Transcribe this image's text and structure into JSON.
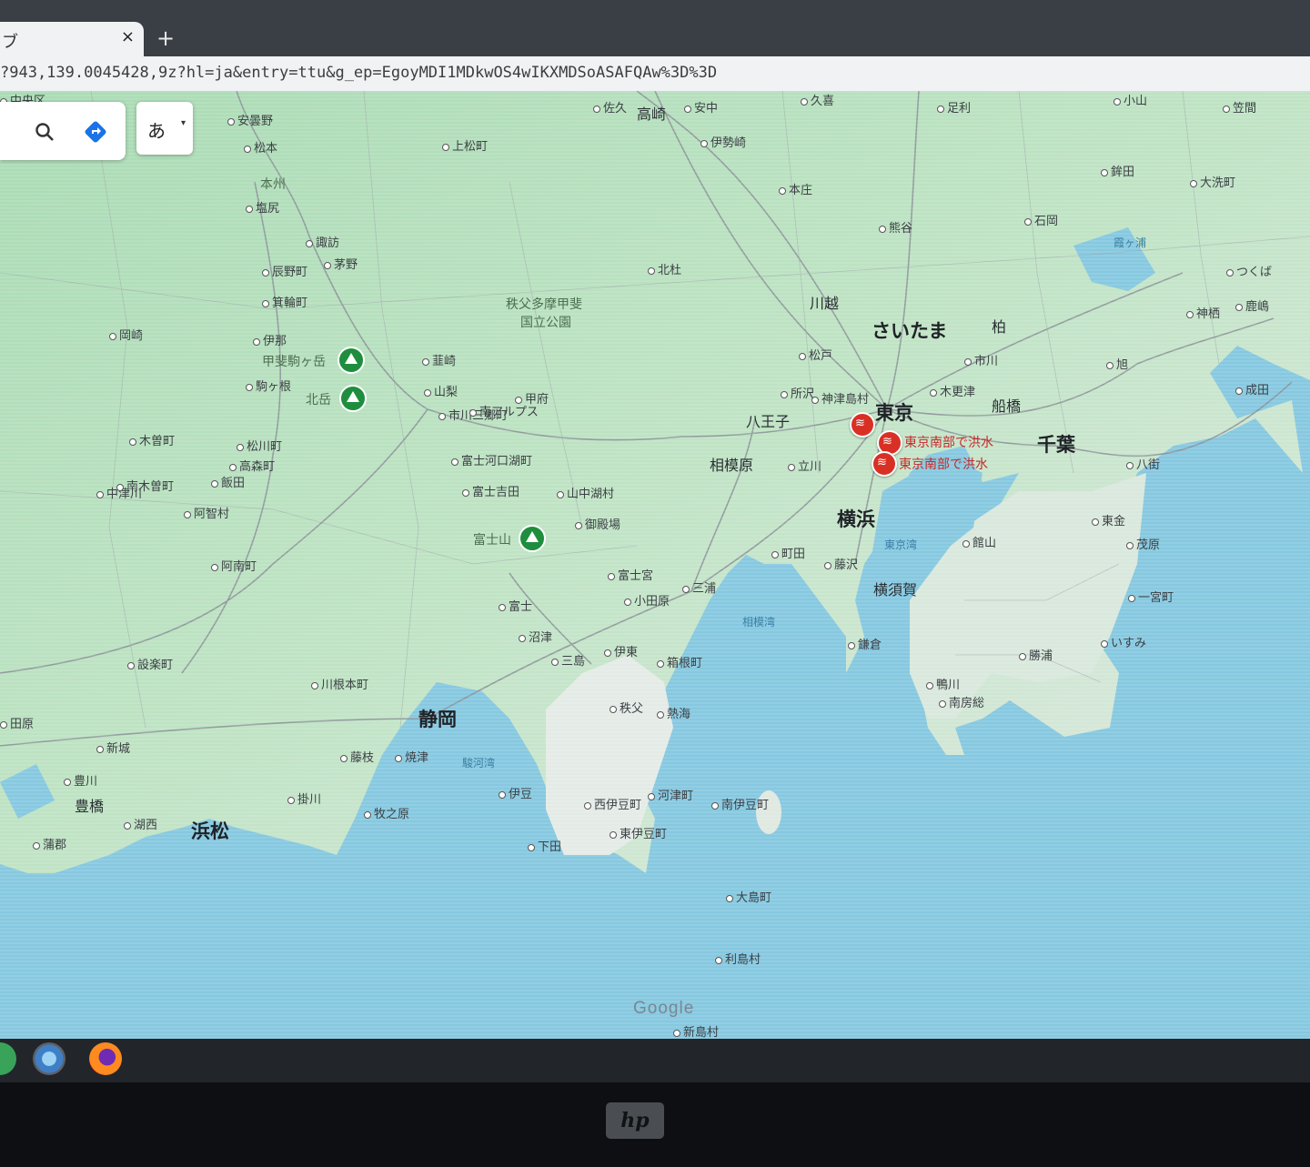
{
  "browser": {
    "tab_title": "ブ",
    "tab_close": "×",
    "new_tab": "+",
    "url": "?943,139.0045428,9z?hl=ja&entry=ttu&g_ep=EgoyMDI1MDkwOS4wIKXMDSoASAFQAw%3D%3D"
  },
  "map_controls": {
    "search_icon": "search-icon",
    "directions_icon": "directions-icon",
    "ime_label": "あ",
    "ime_caret": "▾"
  },
  "colors": {
    "land_low": "#e9ecea",
    "land_high": "#a7d9b2",
    "sea": "#86c8e0",
    "road": "#8a9097",
    "alert": "#d93025",
    "park": "#1e8e3e"
  },
  "labels": {
    "cities": [
      "東京",
      "さいたま",
      "横浜",
      "千葉",
      "静岡",
      "浜松"
    ],
    "mid": [
      "高崎",
      "川越",
      "八王子",
      "相模原",
      "横須賀",
      "船橋",
      "豊橋",
      "柏"
    ],
    "towns": [
      "安曇野",
      "松本",
      "塩尻",
      "諏訪",
      "茅野",
      "辰野町",
      "箕輪町",
      "伊那",
      "駒ヶ根",
      "松川町",
      "高森町",
      "飯田",
      "中津川",
      "阿智村",
      "阿南町",
      "設楽町",
      "川根本町",
      "藤枝",
      "焼津",
      "掛川",
      "牧之原",
      "湖西",
      "新城",
      "豊川",
      "蒲郡",
      "田原",
      "岡崎",
      "木曽町",
      "南木曽町",
      "上松町",
      "佐久",
      "安中",
      "伊勢崎",
      "本庄",
      "熊谷",
      "久喜",
      "足利",
      "小山",
      "笠間",
      "大洗町",
      "鉾田",
      "石岡",
      "つくば",
      "鹿嶋",
      "神栖",
      "成田",
      "旭",
      "八街",
      "東金",
      "茂原",
      "一宮町",
      "いすみ",
      "勝浦",
      "鴨川",
      "南房総",
      "館山",
      "木更津",
      "市川",
      "松戸",
      "所沢",
      "立川",
      "町田",
      "藤沢",
      "鎌倉",
      "三浦",
      "小田原",
      "箱根町",
      "熱海",
      "伊東",
      "三島",
      "沼津",
      "富士",
      "富士宮",
      "御殿場",
      "山中湖村",
      "富士吉田",
      "富士河口湖町",
      "市川三郷町",
      "南アルプス",
      "甲府",
      "山梨",
      "韮崎",
      "北杜",
      "秩父",
      "伊豆",
      "西伊豆町",
      "河津町",
      "東伊豆町",
      "下田",
      "南伊豆町",
      "大島町",
      "利島村",
      "新島村",
      "神津島村",
      "中央区"
    ],
    "parks": [
      "秩父多摩甲斐",
      "国立公園",
      "甲斐駒ヶ岳",
      "北岳",
      "富士山",
      "本州"
    ],
    "sea": [
      "相模湾",
      "駿河湾",
      "東京湾",
      "霞ヶ浦"
    ],
    "alerts": [
      "東京南部で洪水",
      "東京南部で洪水"
    ]
  },
  "google_logo": "Google",
  "taskbar": {
    "icons": [
      "app-icon",
      "browser-icon",
      "firefox-icon"
    ]
  },
  "device": {
    "brand": "hp"
  }
}
